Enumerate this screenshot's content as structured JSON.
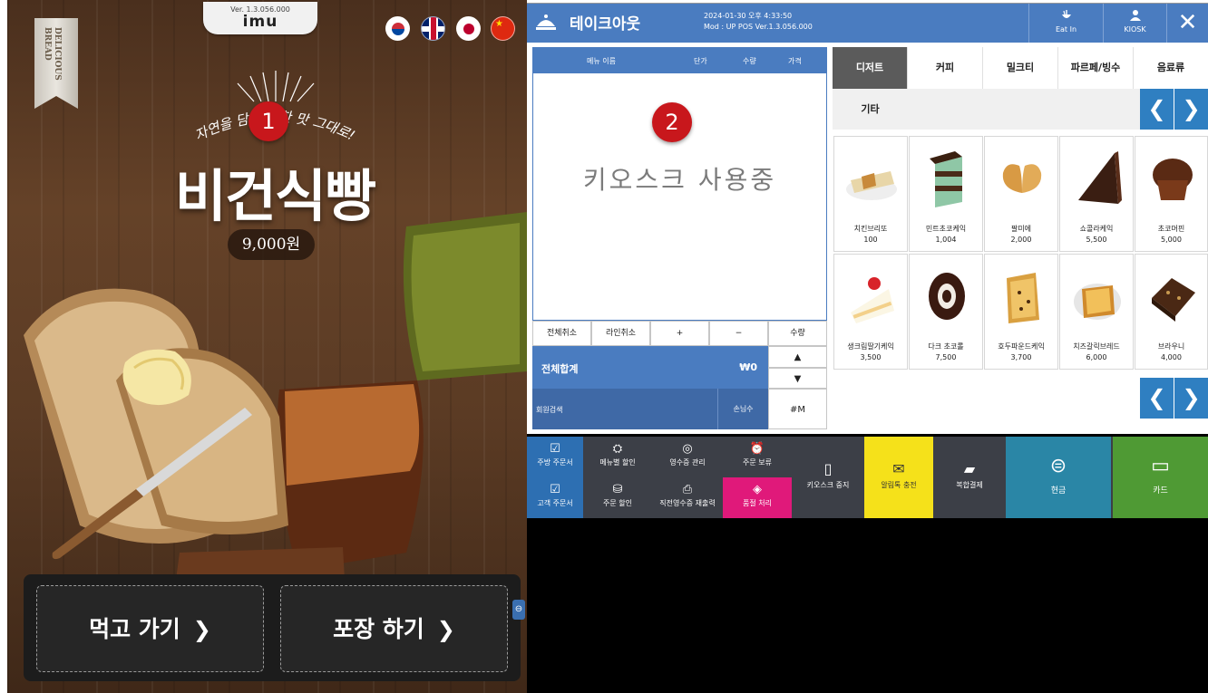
{
  "kiosk": {
    "version": "Ver. 1.3.056.000",
    "logo": "imu",
    "ribbon": "DELICIOUS BREAD",
    "tagline": "자연을 담은 착한 맛 그대로!",
    "product_title": "비건식빵",
    "price": "9,000원",
    "badge": "1",
    "languages": [
      "ko",
      "en",
      "ja",
      "zh"
    ],
    "eat_in_label": "먹고 가기",
    "takeout_label": "포장 하기",
    "chevron": "❯"
  },
  "pos": {
    "title": "테이크아웃",
    "datetime": "2024-01-30 오후 4:33:50",
    "mod_info": "Mod : UP POS Ver.1.3.056.000",
    "eat_in_label": "Eat In",
    "kiosk_label": "KIOSK",
    "close": "✕",
    "badge": "2",
    "cart_headers": {
      "name": "메뉴 이름",
      "unit_price": "단가",
      "qty": "수량",
      "price": "가격"
    },
    "kiosk_in_use": "키오스크 사용중",
    "cart_buttons": {
      "clear_all": "전체취소",
      "clear_line": "라인취소",
      "plus": "+",
      "minus": "−",
      "qty": "수량"
    },
    "total_label": "전체합계",
    "total_value": "₩0",
    "up": "▲",
    "down": "▼",
    "member_search": "회원검색",
    "guests": "손님수",
    "hash_m": "#M",
    "categories": [
      "디저트",
      "커피",
      "밀크티",
      "파르페/빙수",
      "음료류",
      "기타"
    ],
    "active_category": "디저트",
    "nav_prev": "❮",
    "nav_next": "❯",
    "products": [
      {
        "name": "치킨브리또",
        "price": "100"
      },
      {
        "name": "민트초코케익",
        "price": "1,004"
      },
      {
        "name": "팔미에",
        "price": "2,000"
      },
      {
        "name": "쇼콜라케익",
        "price": "5,500"
      },
      {
        "name": "초코머핀",
        "price": "5,000"
      },
      {
        "name": "생크림딸기케익",
        "price": "3,500"
      },
      {
        "name": "다크 초코롤",
        "price": "7,500"
      },
      {
        "name": "호두파운드케익",
        "price": "3,700"
      },
      {
        "name": "치즈갈릭브레드",
        "price": "6,000"
      },
      {
        "name": "브라우니",
        "price": "4,000"
      }
    ],
    "functions": {
      "kitchen_order": "주방 주문서",
      "menu_discount": "메뉴별 할인",
      "receipt_mgmt": "영수증 관리",
      "order_hold": "주문 보류",
      "customer_order": "고객 주문서",
      "order_discount": "주문 할인",
      "reprint_receipt": "직전영수증 재출력",
      "soldout": "품절 처리",
      "kiosk_stop": "키오스크 중지",
      "alimtalk": "알림톡 충전",
      "split_pay": "복합결제",
      "cash": "현금",
      "card": "카드"
    },
    "colors": {
      "header_blue": "#4a7cc0",
      "nav_blue": "#2f7fc1",
      "soldout_pink": "#e0197a",
      "alimtalk_yellow": "#f5e11a",
      "cash_teal": "#2a86a6",
      "card_green": "#4f9a34",
      "badge_red": "#c8171c"
    }
  }
}
